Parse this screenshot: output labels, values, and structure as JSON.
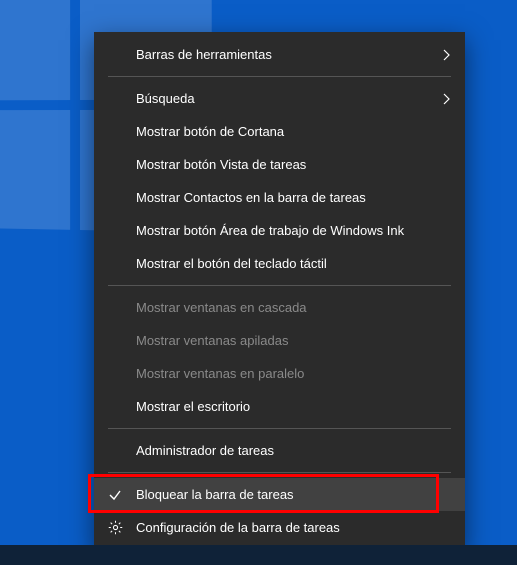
{
  "menu": {
    "toolbars": {
      "label": "Barras de herramientas",
      "has_submenu": true
    },
    "search": {
      "label": "Búsqueda",
      "has_submenu": true
    },
    "cortana": {
      "label": "Mostrar botón de Cortana"
    },
    "taskview": {
      "label": "Mostrar botón Vista de tareas"
    },
    "contacts": {
      "label": "Mostrar Contactos en la barra de tareas"
    },
    "ink": {
      "label": "Mostrar botón Área de trabajo de Windows Ink"
    },
    "touchkb": {
      "label": "Mostrar el botón del teclado táctil"
    },
    "cascade": {
      "label": "Mostrar ventanas en cascada",
      "disabled": true
    },
    "stacked": {
      "label": "Mostrar ventanas apiladas",
      "disabled": true
    },
    "sidebyside": {
      "label": "Mostrar ventanas en paralelo",
      "disabled": true
    },
    "showdesktop": {
      "label": "Mostrar el escritorio"
    },
    "taskmgr": {
      "label": "Administrador de tareas"
    },
    "lock": {
      "label": "Bloquear la barra de tareas",
      "checked": true,
      "hover": true
    },
    "settings": {
      "label": "Configuración de la barra de tareas"
    }
  },
  "highlight": {
    "target": "lock"
  }
}
